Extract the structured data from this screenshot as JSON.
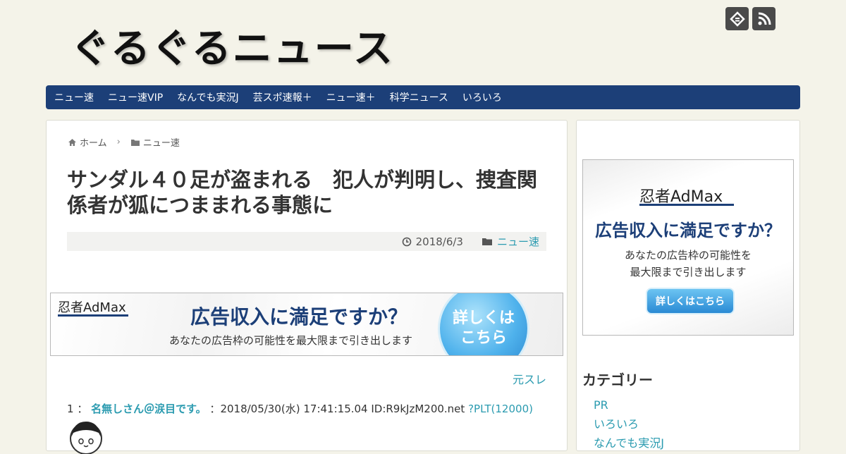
{
  "site": {
    "title": "ぐるぐるニュース"
  },
  "header_icons": [
    {
      "name": "feedly-icon"
    },
    {
      "name": "rss-icon"
    }
  ],
  "nav": {
    "items": [
      "ニュー速",
      "ニュー速VIP",
      "なんでも実況J",
      "芸スポ速報＋",
      "ニュー速＋",
      "科学ニュース",
      "いろいろ"
    ]
  },
  "breadcrumb": {
    "home": "ホーム",
    "category": "ニュー速"
  },
  "article": {
    "title": "サンダル４０足が盗まれる　犯人が判明し、捜査関係者が狐につままれる事態に",
    "date": "2018/6/3",
    "category": "ニュー速",
    "source_link": "元スレ"
  },
  "ad_banner": {
    "logo": "忍者AdMax",
    "headline": "広告収入に満足ですか？",
    "sub": "あなたの広告枠の可能性を最大限まで引き出します",
    "button": "詳しくは\nこちら"
  },
  "comment": {
    "number": "1",
    "sep1": "：",
    "name": "名無しさん＠涙目です。",
    "sep2": "：",
    "datetime": "2018/05/30(水) 17:41:15.04 ID:R9kJzM200.net",
    "plt": "?PLT(12000)"
  },
  "sidebar": {
    "ad": {
      "logo": "忍者AdMax",
      "headline": "広告収入に満足ですか？",
      "line1": "あなたの広告枠の可能性を",
      "line2": "最大限まで引き出します",
      "button": "詳しくはこちら"
    },
    "category_title": "カテゴリー",
    "categories": [
      "PR",
      "いろいろ",
      "なんでも実況J"
    ]
  },
  "colors": {
    "nav_bg": "#1c3f78",
    "page_bg": "#f4f3e9",
    "link": "#2b9bb0"
  }
}
